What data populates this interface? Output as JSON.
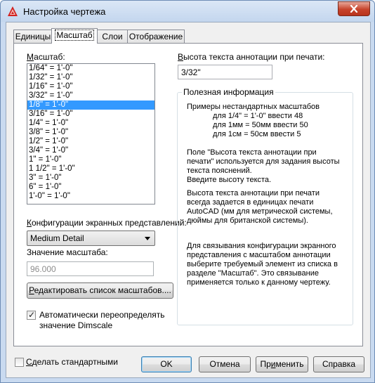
{
  "window": {
    "title": "Настройка чертежа"
  },
  "tabs": [
    "Единицы",
    "Масштаб",
    "Слои",
    "Отображение"
  ],
  "scale": {
    "label_prefix": "",
    "label_hot": "М",
    "label_rest": "асштаб:",
    "items": [
      "1/64\" = 1'-0\"",
      "1/32\" = 1'-0\"",
      "1/16\" = 1'-0\"",
      "3/32\" = 1'-0\"",
      "1/8\" = 1'-0\"",
      "3/16\" = 1'-0\"",
      "1/4\" = 1'-0\"",
      "3/8\" = 1'-0\"",
      "1/2\" = 1'-0\"",
      "3/4\" = 1'-0\"",
      "1\" = 1'-0\"",
      "1 1/2\" = 1'-0\"",
      "3\" = 1'-0\"",
      "6\" = 1'-0\"",
      "1'-0\" = 1'-0\""
    ],
    "selected_index": 4
  },
  "viewconfig": {
    "label_hot": "К",
    "label_rest": "онфигурации экранных представлений:",
    "value": "Medium Detail"
  },
  "scalevalue": {
    "label": "Значение масштаба:",
    "value": "96.000"
  },
  "edit_button": {
    "hot": "Р",
    "rest": "едактировать список масштабов...."
  },
  "dimscale": {
    "line1": "Автоматически переопределять",
    "line2": "значение Dimscale",
    "checked": true
  },
  "annotation": {
    "label_hot": "В",
    "label_rest": "ысота текста аннотации при печати:",
    "value": "3/32\""
  },
  "info": {
    "title": "Полезная информация",
    "lines": [
      "Примеры нестандартных масштабов",
      "для 1/4\" = 1'-0\" ввести 48",
      "для 1мм = 50мм ввести 50",
      "для 1см = 50см ввести 5",
      "Поле \"Высота текста аннотации при",
      "печати\" используется для задания высоты",
      "текста пояснений.",
      "Введите высоту текста.",
      "Высота текста аннотации при печати",
      "всегда задается в единицах печати",
      "AutoCAD (мм для метрической системы,",
      "дюймы для британской системы).",
      "Для связывания конфигурации экранного",
      "представления с масштабом аннотации",
      "выберите требуемый элемент из списка в",
      "разделе \"Масштаб\". Это связывание",
      "применяется только к данному чертежу."
    ]
  },
  "footer": {
    "make_standard": {
      "hot": "С",
      "rest": "делать стандартными"
    },
    "ok": "OK",
    "cancel": "Отмена",
    "apply": {
      "pre": "Пр",
      "hot": "и",
      "rest": "менить"
    },
    "help": "Справка"
  },
  "colors": {
    "selection": "#3399ff",
    "close_button": "#c7432b",
    "frame": "#c9daf0"
  }
}
